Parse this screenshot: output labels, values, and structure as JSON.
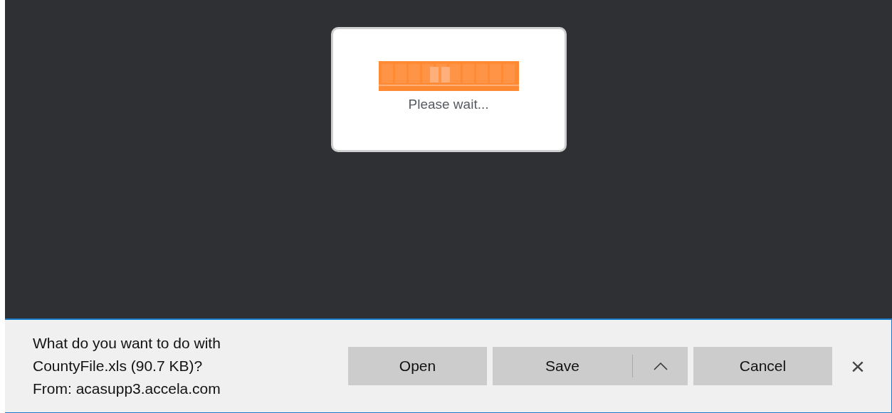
{
  "loading_dialog": {
    "message": "Please wait..."
  },
  "download_bar": {
    "lines": [
      "What do you want to do with",
      "CountyFile.xls (90.7 KB)?",
      "From: acasupp3.accela.com"
    ],
    "buttons": [
      {
        "label": "Open",
        "kind": "plain"
      },
      {
        "label": "Save",
        "kind": "split"
      },
      {
        "label": "Cancel",
        "kind": "plain"
      }
    ],
    "close": "×"
  }
}
